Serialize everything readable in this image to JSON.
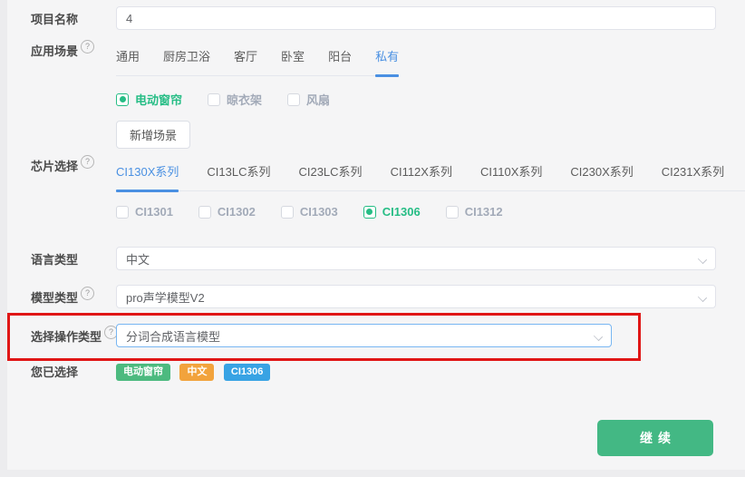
{
  "colors": {
    "page_bg": "#f5f5f6",
    "accent_blue": "#4a90e2",
    "accent_green": "#26bd85",
    "button_green": "#43b884",
    "tag_green": "#4cba7f",
    "tag_orange": "#f2a33c",
    "tag_blue": "#38a3e4",
    "annotation_red": "#e01616"
  },
  "icons": {
    "help_glyph": "?"
  },
  "annotation": {
    "type": "highlight-box",
    "target": "operation-type-row",
    "color": "#e01616"
  },
  "form": {
    "project_name": {
      "label": "项目名称",
      "value": "4"
    },
    "scene": {
      "label": "应用场景",
      "tabs": [
        "通用",
        "厨房卫浴",
        "客厅",
        "卧室",
        "阳台",
        "私有"
      ],
      "active_tab": "私有",
      "options": [
        {
          "label": "电动窗帘",
          "checked": true
        },
        {
          "label": "晾衣架",
          "checked": false
        },
        {
          "label": "风扇",
          "checked": false
        }
      ],
      "add_button": "新增场景"
    },
    "chip": {
      "label": "芯片选择",
      "tabs": [
        "CI130X系列",
        "CI13LC系列",
        "CI23LC系列",
        "CI112X系列",
        "CI110X系列",
        "CI230X系列",
        "CI231X系列"
      ],
      "active_tab": "CI130X系列",
      "options": [
        {
          "label": "CI1301",
          "checked": false
        },
        {
          "label": "CI1302",
          "checked": false
        },
        {
          "label": "CI1303",
          "checked": false
        },
        {
          "label": "CI1306",
          "checked": true
        },
        {
          "label": "CI1312",
          "checked": false
        }
      ]
    },
    "language": {
      "label": "语言类型",
      "value": "中文"
    },
    "model": {
      "label": "模型类型",
      "value": "pro声学模型V2"
    },
    "operation": {
      "label": "选择操作类型",
      "value": "分词合成语言模型"
    },
    "selected": {
      "label": "您已选择",
      "tags": [
        {
          "text": "电动窗帘",
          "color": "#4cba7f"
        },
        {
          "text": "中文",
          "color": "#f2a33c"
        },
        {
          "text": "CI1306",
          "color": "#38a3e4"
        }
      ]
    },
    "continue_button": "继续"
  }
}
